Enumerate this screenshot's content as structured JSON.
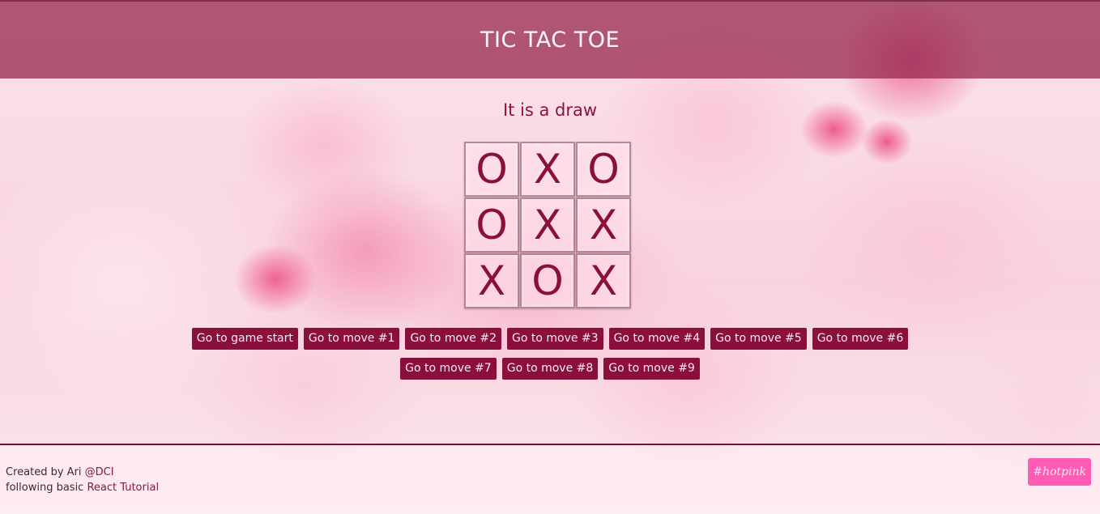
{
  "header": {
    "title": "TIC TAC TOE"
  },
  "game": {
    "status": "It is a draw",
    "board": [
      "O",
      "X",
      "O",
      "O",
      "X",
      "X",
      "X",
      "O",
      "X"
    ]
  },
  "moves": [
    "Go to game start",
    "Go to move #1",
    "Go to move #2",
    "Go to move #3",
    "Go to move #4",
    "Go to move #5",
    "Go to move #6",
    "Go to move #7",
    "Go to move #8",
    "Go to move #9"
  ],
  "footer": {
    "created_by": "Created by Ari ",
    "org_link": "@DCI",
    "following": "following basic ",
    "tutorial_link": "React Tutorial",
    "theme_button": "#hotpink"
  },
  "colors": {
    "accent": "#8a0f3d",
    "header_bg": "#9b2d55",
    "theme_button": "#ff5cb6"
  }
}
